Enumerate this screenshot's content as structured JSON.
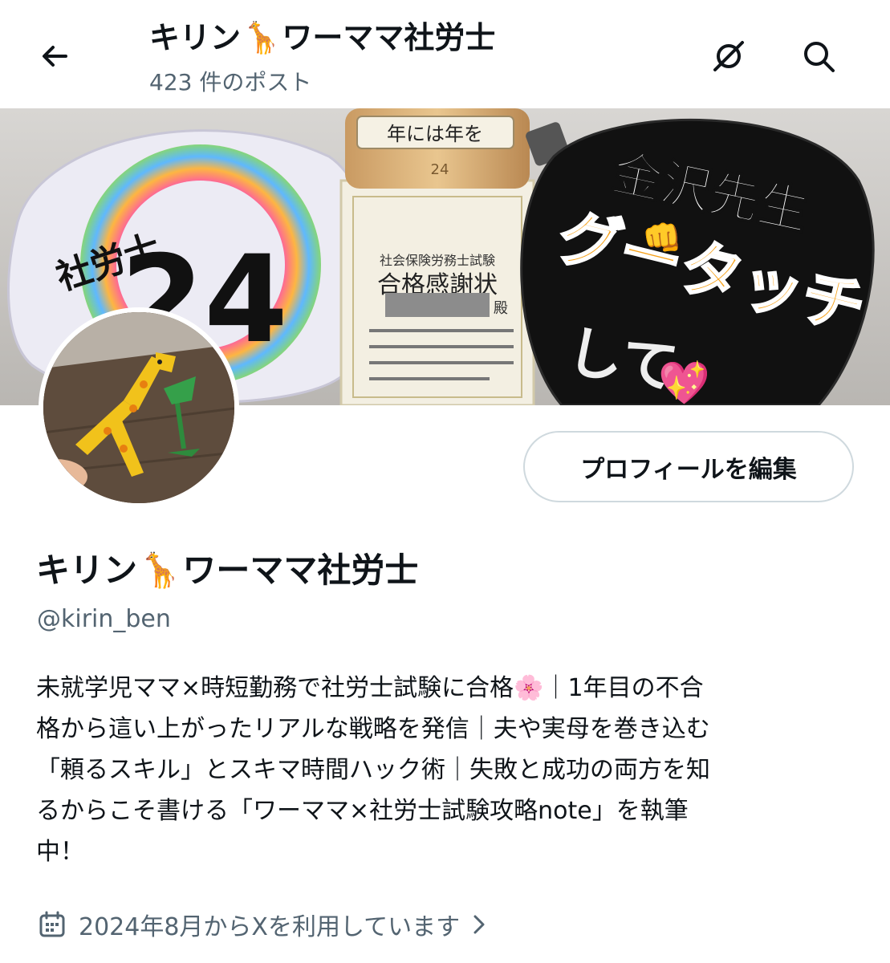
{
  "header": {
    "title_left": "キリン",
    "title_emoji": "🦒",
    "title_right": "ワーママ社労士",
    "post_count": "423 件のポスト"
  },
  "banner": {
    "fan_left_label": "社労士",
    "fan_left_number": "24",
    "bottle_label": "年には年を",
    "bottle_sub": "24",
    "certificate_subtitle": "社会保険労務士試験",
    "certificate_title": "合格感謝状",
    "certificate_suffix": "殿",
    "fan_right_line1": "金沢先生",
    "fan_right_line2": "グータッチ",
    "fan_right_line3": "して",
    "fan_right_fist": "👊",
    "fan_right_heart": "💖"
  },
  "profile": {
    "edit_button_label": "プロフィールを編集",
    "name_left": "キリン",
    "name_emoji": "🦒",
    "name_right": "ワーママ社労士",
    "handle": "@kirin_ben",
    "bio_lines": [
      "未就学児ママ×時短勤務で社労士試験に合格🌸｜1年目の不合",
      "格から這い上がったリアルな戦略を発信｜夫や実母を巻き込む",
      "「頼るスキル」とスキマ時間ハック術｜失敗と成功の両方を知",
      "るからこそ書ける「ワーママ×社労士試験攻略note」を執筆",
      "中！"
    ],
    "joined": "2024年8月からXを利用しています"
  },
  "colors": {
    "text_primary": "#0f1419",
    "text_secondary": "#536471",
    "border": "#cfd9de"
  },
  "icons": [
    "back-arrow-icon",
    "notification-off-icon",
    "search-icon",
    "calendar-icon",
    "chevron-right-icon"
  ]
}
